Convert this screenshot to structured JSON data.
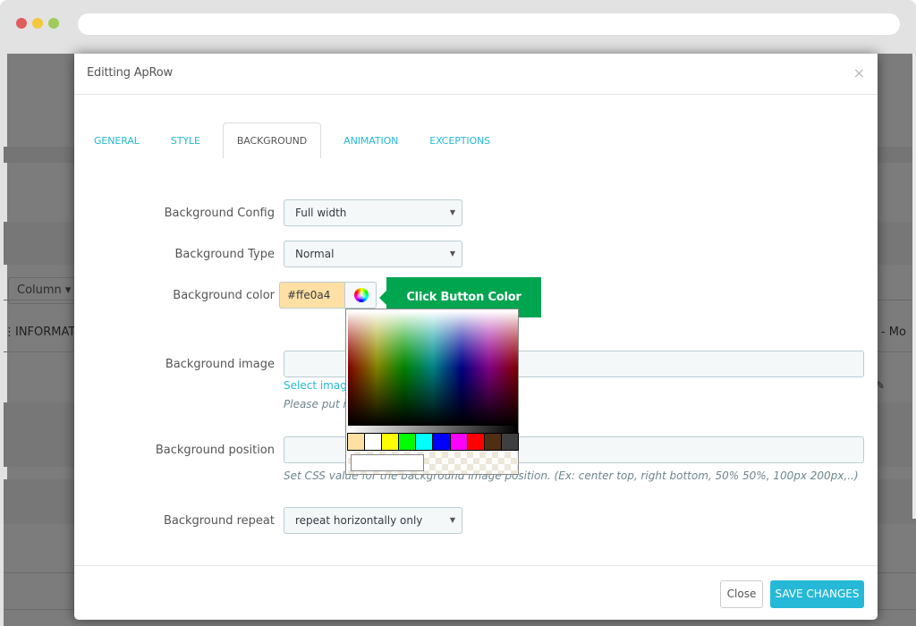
{
  "browser": {
    "window_dots": [
      {
        "name": "close",
        "color": "#e05d5d"
      },
      {
        "name": "minimize",
        "color": "#f5c73d"
      },
      {
        "name": "maximize",
        "color": "#9fcb5a"
      }
    ]
  },
  "background_page": {
    "column_button": "Column ▾",
    "row_text_left": "INFORMAT",
    "row_text_right": "s - Mo"
  },
  "modal": {
    "title": "Editting ApRow",
    "close_icon": "×",
    "tabs": [
      {
        "label": "GENERAL",
        "active": false
      },
      {
        "label": "STYLE",
        "active": false
      },
      {
        "label": "BACKGROUND",
        "active": true
      },
      {
        "label": "ANIMATION",
        "active": false
      },
      {
        "label": "EXCEPTIONS",
        "active": false
      }
    ],
    "fields": {
      "background_config": {
        "label": "Background Config",
        "value": "Full width"
      },
      "background_type": {
        "label": "Background Type",
        "value": "Normal"
      },
      "background_color": {
        "label": "Background color",
        "value": "#ffe0a4",
        "swatch_color": "#ffe0a4"
      },
      "background_image": {
        "label": "Background image",
        "value": "",
        "link": "Select image",
        "help": "Please put i"
      },
      "background_position": {
        "label": "Background position",
        "value": "",
        "help": "Set CSS value for the background image position. (Ex: center top, right bottom, 50% 50%, 100px 200px,..)"
      },
      "background_repeat": {
        "label": "Background repeat",
        "value": "repeat horizontally only"
      }
    },
    "tooltip": "Click  Button Color",
    "color_picker": {
      "swatches": [
        "#ffe0a4",
        "#ffffff",
        "#ffff00",
        "#00ff00",
        "#00ffff",
        "#0000ff",
        "#ff00ff",
        "#ff0000",
        "#4f2e14",
        "#3f3f3f"
      ],
      "hex_value": ""
    },
    "footer": {
      "close_label": "Close",
      "save_label": "SAVE CHANGES"
    }
  },
  "colors": {
    "accent": "#25b9d7",
    "tooltip_green": "#00a550"
  }
}
